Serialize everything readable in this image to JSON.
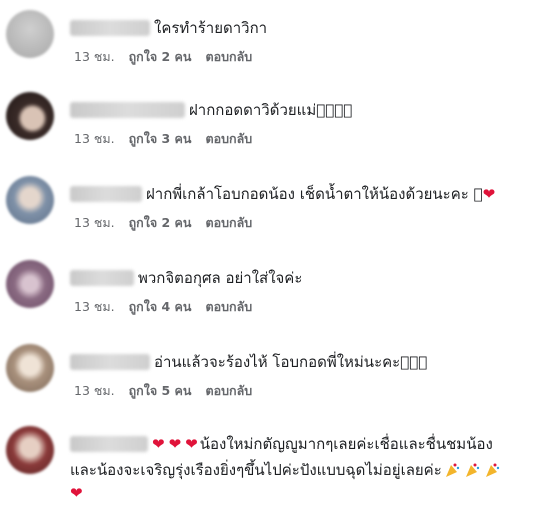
{
  "comments": [
    {
      "text": "ใครทำร้ายดาวิกา",
      "time": "13 ชม.",
      "likes": "ถูกใจ 2 คน",
      "reply": "ตอบกลับ",
      "avatar_color": "#b9b9b9"
    },
    {
      "text": "ฝากกอดดาวิด้วยแม่􏿿􏿿􏿿􏿿",
      "time": "13 ชม.",
      "likes": "ถูกใจ 3 คน",
      "reply": "ตอบกลับ",
      "avatar_color": "#4a3a36"
    },
    {
      "text": "ฝากพี่เกล้าโอบกอดน้อง เช็ดน้ำตาให้น้องด้วยนะคะ 􏿿",
      "time": "13 ชม.",
      "likes": "ถูกใจ 2 คน",
      "reply": "ตอบกลับ",
      "avatar_color": "#8a9bb0"
    },
    {
      "text": "พวกจิตอกุศล อย่าใส่ใจค่ะ",
      "time": "13 ชม.",
      "likes": "ถูกใจ 4 คน",
      "reply": "ตอบกลับ",
      "avatar_color": "#8e6f84"
    },
    {
      "text": "อ่านแล้วจะร้องไห้ โอบกอดพี่ใหม่นะคะ􏿿􏿿􏿿",
      "time": "13 ชม.",
      "likes": "ถูกใจ 5 คน",
      "reply": "ตอบกลับ",
      "avatar_color": "#a39080"
    },
    {
      "text_line1": "น้องใหม่กตัญญูมากๆเลยค่ะเชื่อและชื่นชมน้อง",
      "text_line2": "และน้องจะเจริญรุ่งเรืองยิ่งๆขึ้นไปค่ะปังแบบฉุดไม่อยู่เลยค่ะ",
      "avatar_color": "#8a3a3a"
    }
  ],
  "colors": {
    "heart": "#e0133a",
    "meta_text": "#65676b"
  }
}
